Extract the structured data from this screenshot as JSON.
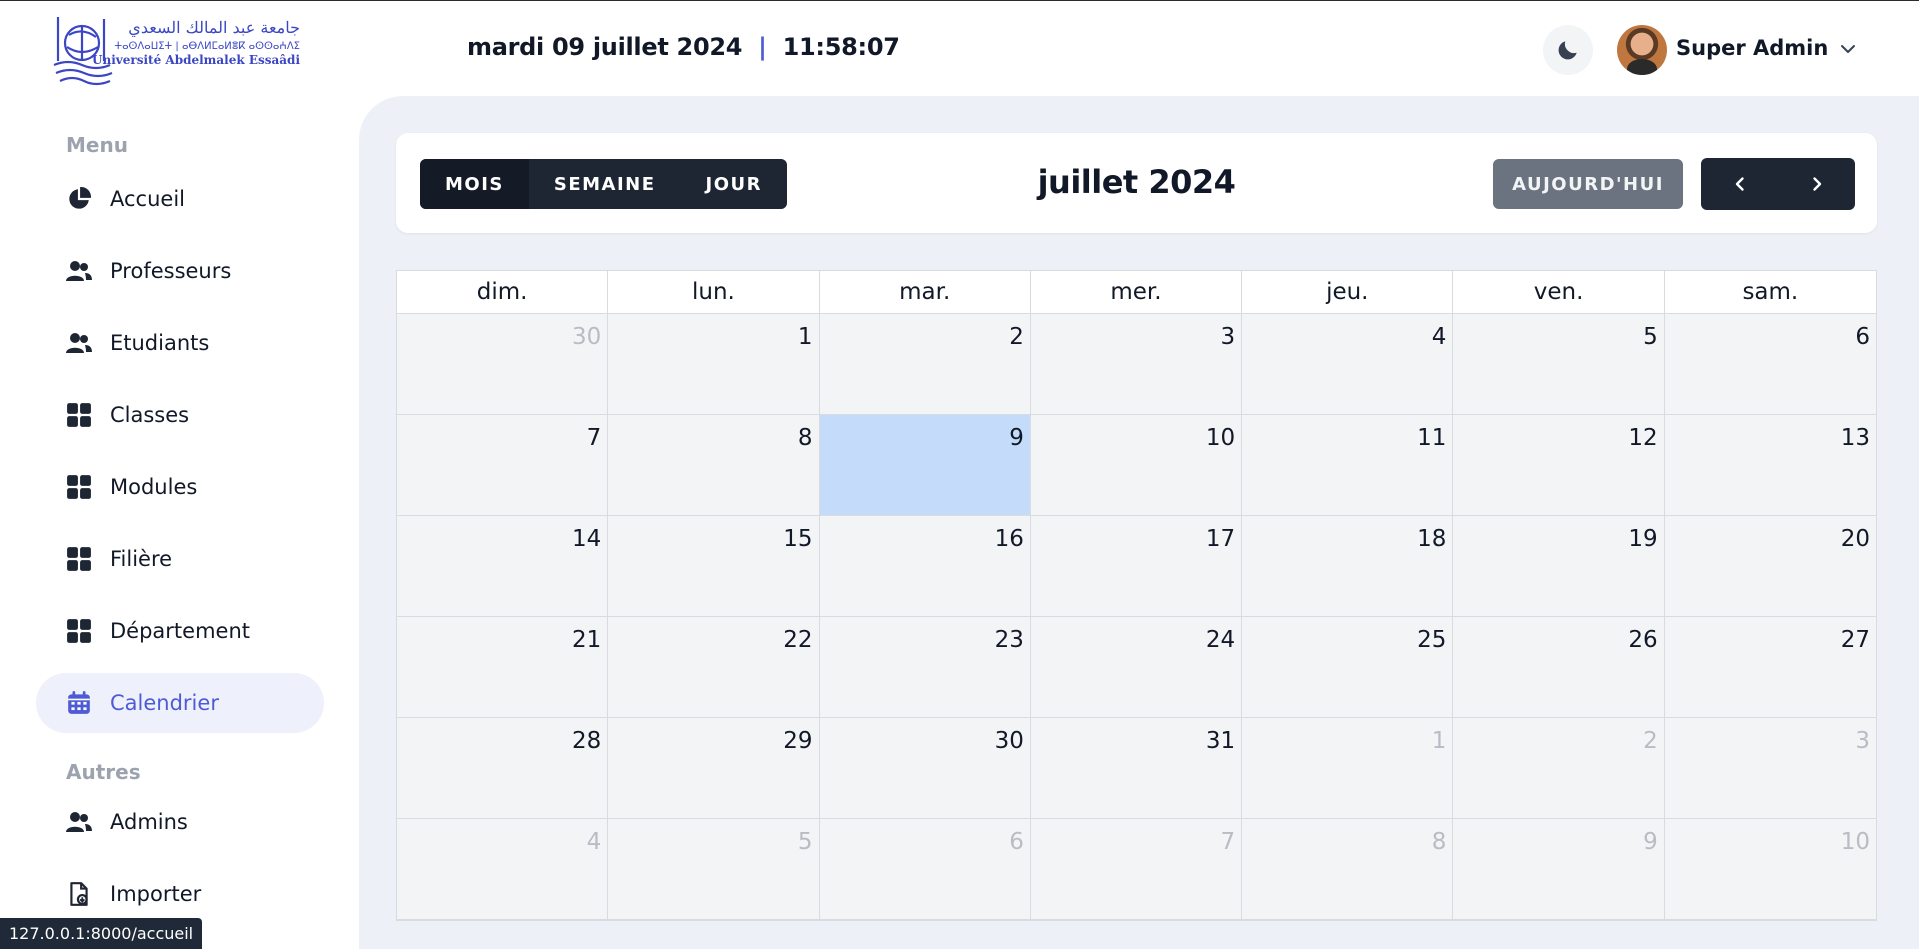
{
  "header": {
    "logo": {
      "arabic": "جامعة عبد المالك السعدي",
      "tifinagh": "ⵜⴰⵙⴷⴰⵡⵉⵜ | ⴰⴱⴷⵍⵎⴰⵍⴻⴽ ⴰⵙⵙⴰⵄⴷⵉ",
      "french": "Université Abdelmalek Essaâdi"
    },
    "date": "mardi 09 juillet 2024",
    "separator": "|",
    "time": "11:58:07",
    "theme_icon": "moon-icon",
    "user_name": "Super Admin",
    "user_menu_icon": "chevron-down-icon"
  },
  "sidebar": {
    "menu_heading": "Menu",
    "items": [
      {
        "label": "Accueil",
        "icon": "pie-chart-icon"
      },
      {
        "label": "Professeurs",
        "icon": "users-icon"
      },
      {
        "label": "Etudiants",
        "icon": "users-icon"
      },
      {
        "label": "Classes",
        "icon": "grid-icon"
      },
      {
        "label": "Modules",
        "icon": "grid-icon"
      },
      {
        "label": "Filière",
        "icon": "grid-icon"
      },
      {
        "label": "Département",
        "icon": "grid-icon"
      },
      {
        "label": "Calendrier",
        "icon": "calendar-icon",
        "active": true
      }
    ],
    "other_heading": "Autres",
    "other_items": [
      {
        "label": "Admins",
        "icon": "users-icon"
      },
      {
        "label": "Importer",
        "icon": "file-import-icon"
      }
    ]
  },
  "calendar": {
    "views": [
      "MOIS",
      "SEMAINE",
      "JOUR"
    ],
    "active_view": "MOIS",
    "title": "juillet 2024",
    "today_label": "AUJOURD'HUI",
    "prev_icon": "chevron-left-icon",
    "next_icon": "chevron-right-icon",
    "weekdays": [
      "dim.",
      "lun.",
      "mar.",
      "mer.",
      "jeu.",
      "ven.",
      "sam."
    ],
    "today_day": "9",
    "days": [
      {
        "d": "30",
        "other": true
      },
      {
        "d": "1"
      },
      {
        "d": "2"
      },
      {
        "d": "3"
      },
      {
        "d": "4"
      },
      {
        "d": "5"
      },
      {
        "d": "6"
      },
      {
        "d": "7"
      },
      {
        "d": "8"
      },
      {
        "d": "9",
        "today": true
      },
      {
        "d": "10"
      },
      {
        "d": "11"
      },
      {
        "d": "12"
      },
      {
        "d": "13"
      },
      {
        "d": "14"
      },
      {
        "d": "15"
      },
      {
        "d": "16"
      },
      {
        "d": "17"
      },
      {
        "d": "18"
      },
      {
        "d": "19"
      },
      {
        "d": "20"
      },
      {
        "d": "21"
      },
      {
        "d": "22"
      },
      {
        "d": "23"
      },
      {
        "d": "24"
      },
      {
        "d": "25"
      },
      {
        "d": "26"
      },
      {
        "d": "27"
      },
      {
        "d": "28"
      },
      {
        "d": "29"
      },
      {
        "d": "30"
      },
      {
        "d": "31"
      },
      {
        "d": "1",
        "other": true
      },
      {
        "d": "2",
        "other": true
      },
      {
        "d": "3",
        "other": true
      },
      {
        "d": "4",
        "other": true
      },
      {
        "d": "5",
        "other": true
      },
      {
        "d": "6",
        "other": true
      },
      {
        "d": "7",
        "other": true
      },
      {
        "d": "8",
        "other": true
      },
      {
        "d": "9",
        "other": true
      },
      {
        "d": "10",
        "other": true
      }
    ]
  },
  "status_bar": {
    "url": "127.0.0.1:8000/accueil"
  },
  "colors": {
    "accent": "#4f5bd5",
    "dark_button": "#1e2533",
    "today_cell": "#c4dcf9",
    "muted_button": "#6b7280"
  }
}
